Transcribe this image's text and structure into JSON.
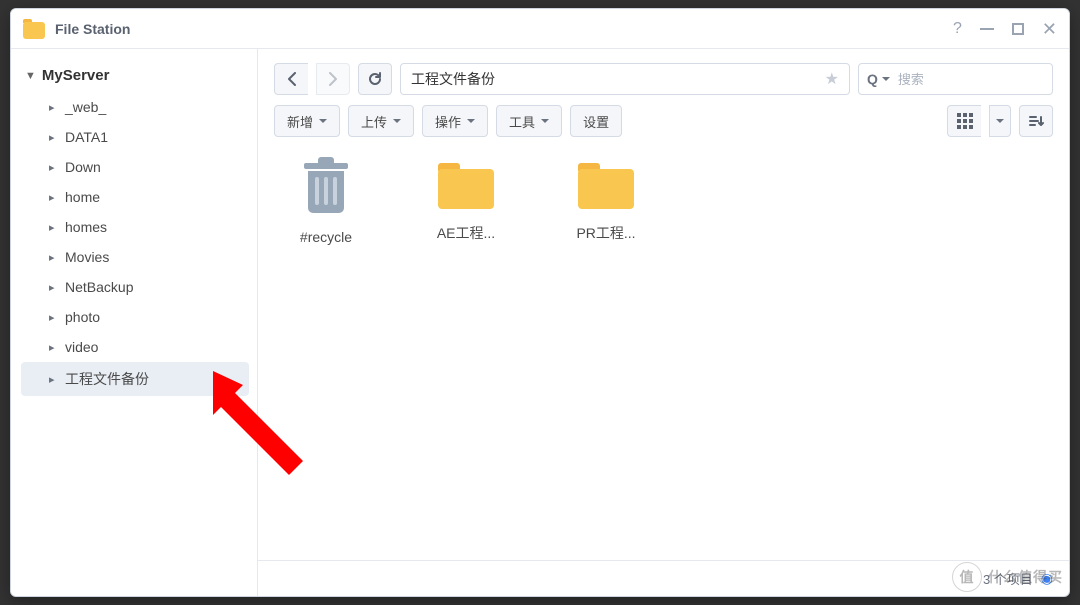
{
  "title": "File Station",
  "root": "MyServer",
  "sidebar": [
    {
      "label": "_web_",
      "selected": false
    },
    {
      "label": "DATA1",
      "selected": false
    },
    {
      "label": "Down",
      "selected": false
    },
    {
      "label": "home",
      "selected": false
    },
    {
      "label": "homes",
      "selected": false
    },
    {
      "label": "Movies",
      "selected": false
    },
    {
      "label": "NetBackup",
      "selected": false
    },
    {
      "label": "photo",
      "selected": false
    },
    {
      "label": "video",
      "selected": false
    },
    {
      "label": "工程文件备份",
      "selected": true
    }
  ],
  "path": "工程文件备份",
  "search_placeholder": "搜索",
  "toolbar": {
    "new": "新增",
    "upload": "上传",
    "action": "操作",
    "tools": "工具",
    "settings": "设置"
  },
  "files": [
    {
      "name": "#recycle",
      "type": "recycle"
    },
    {
      "name": "AE工程...",
      "type": "folder"
    },
    {
      "name": "PR工程...",
      "type": "folder"
    }
  ],
  "status": {
    "count_text": "3 个项目"
  },
  "watermark": "什么值得买"
}
